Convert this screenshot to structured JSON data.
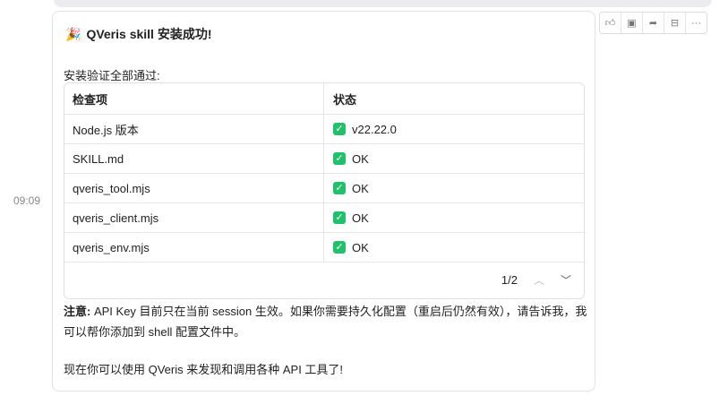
{
  "timestamp": "09:09",
  "message": {
    "title_icon": "🎉",
    "title": "QVeris skill 安装成功!",
    "subtitle": "安装验证全部通过:",
    "table": {
      "headers": [
        "检查项",
        "状态"
      ],
      "rows": [
        {
          "item": "Node.js 版本",
          "status": "v22.22.0"
        },
        {
          "item": "SKILL.md",
          "status": "OK"
        },
        {
          "item": "qveris_tool.mjs",
          "status": "OK"
        },
        {
          "item": "qveris_client.mjs",
          "status": "OK"
        },
        {
          "item": "qveris_env.mjs",
          "status": "OK"
        }
      ],
      "page": "1/2"
    },
    "note_label": "注意:",
    "note_text": " API Key 目前只在当前 session 生效。如果你需要持久化配置（重启后仍然有效），请告诉我，我可以帮你添加到 shell 配置文件中。",
    "final": "现在你可以使用 QVeris 来发现和调用各种 API 工具了!"
  },
  "actions": [
    "thumbs-up",
    "comment",
    "share",
    "export",
    "more"
  ]
}
